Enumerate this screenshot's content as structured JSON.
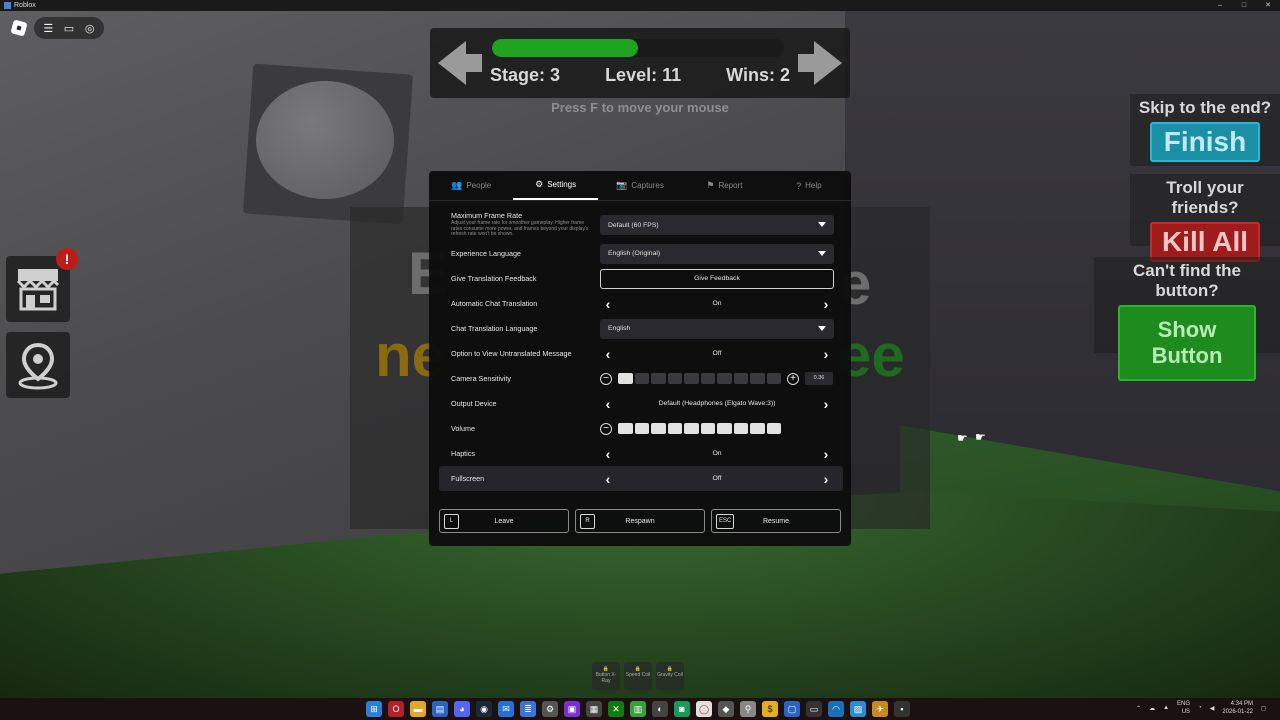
{
  "window": {
    "title": "Roblox",
    "controls": [
      "–",
      "□",
      "✕"
    ]
  },
  "roblox_menu": {
    "icons": [
      "menu-icon",
      "chat-icon",
      "headset-icon"
    ],
    "icon_glyphs": [
      "☰",
      "▭",
      "◎"
    ]
  },
  "hud": {
    "progress": 0.5,
    "stage": "Stage: 3",
    "level": "Level: 11",
    "wins": "Wins: 2",
    "hint": "Press F to move your mouse"
  },
  "board": {
    "word1": "E",
    "word2": "e",
    "word3": "ne",
    "word4": "ee"
  },
  "promos": {
    "skip_question": "Skip to the end?",
    "skip_button": "Finish",
    "troll_question": "Troll your friends?",
    "troll_button": "Kill All",
    "find_question": "Can't find the button?",
    "find_button": "Show Button"
  },
  "side": {
    "badge": "!"
  },
  "settings": {
    "tabs": [
      {
        "label": "People",
        "icon": "people-icon",
        "glyph": "👥"
      },
      {
        "label": "Settings",
        "icon": "gear-icon",
        "glyph": "⚙"
      },
      {
        "label": "Captures",
        "icon": "camera-icon",
        "glyph": "📷"
      },
      {
        "label": "Report",
        "icon": "flag-icon",
        "glyph": "⚑"
      },
      {
        "label": "Help",
        "icon": "help-icon",
        "glyph": "?"
      }
    ],
    "rows": {
      "frame_rate": {
        "label": "Maximum Frame Rate",
        "desc": "Adjust your frame rate for smoother gameplay. Higher frame rates consume more power, and frames beyond your display's refresh rate won't be shown.",
        "value": "Default (60 FPS)"
      },
      "language": {
        "label": "Experience Language",
        "value": "English (Original)"
      },
      "feedback": {
        "label": "Give Translation Feedback",
        "value": "Give Feedback"
      },
      "auto_translate": {
        "label": "Automatic Chat Translation",
        "value": "On"
      },
      "chat_lang": {
        "label": "Chat Translation Language",
        "value": "English"
      },
      "untranslated": {
        "label": "Option to View Untranslated Message",
        "value": "Off"
      },
      "camera": {
        "label": "Camera Sensitivity",
        "value": "0.36",
        "level": 0.1
      },
      "output": {
        "label": "Output Device",
        "value": "Default (Headphones (Elgato Wave:3))"
      },
      "volume": {
        "label": "Volume",
        "level": 1.0
      },
      "haptics": {
        "label": "Haptics",
        "value": "On"
      },
      "fullscreen": {
        "label": "Fullscreen",
        "value": "Off"
      }
    },
    "buttons": {
      "leave": {
        "key": "L",
        "label": "Leave"
      },
      "respawn": {
        "key": "R",
        "label": "Respawn"
      },
      "resume": {
        "key": "ESC",
        "label": "Resume"
      }
    }
  },
  "abilities": [
    "Button X-Ray",
    "Speed Coil",
    "Gravity Coil"
  ],
  "taskbar": {
    "tray_lang": "ENG",
    "tray_region": "US",
    "time": "4:34 PM",
    "date": "2026-01-22"
  },
  "colors": {
    "progress": "#1fa41f",
    "finish": "#1b8fa4",
    "kill": "#9e1c1c",
    "show": "#1e8b1e"
  }
}
